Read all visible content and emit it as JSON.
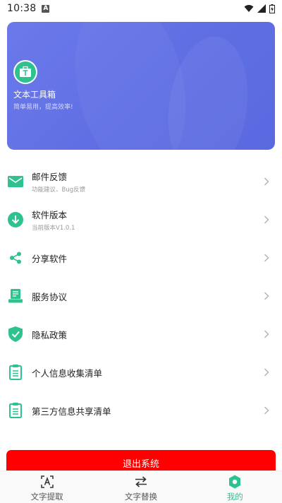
{
  "status_bar": {
    "time": "10:38",
    "notif_letter": "A"
  },
  "profile": {
    "app_name": "文本工具箱",
    "slogan": "简单易用，提高效率!"
  },
  "menu": [
    {
      "title": "邮件反馈",
      "subtitle": "功能建议、Bug反馈",
      "icon": "mail-icon"
    },
    {
      "title": "软件版本",
      "subtitle": "当前版本V1.0.1",
      "icon": "download-icon"
    },
    {
      "title": "分享软件",
      "subtitle": "",
      "icon": "share-icon"
    },
    {
      "title": "服务协议",
      "subtitle": "",
      "icon": "agreement-icon"
    },
    {
      "title": "隐私政策",
      "subtitle": "",
      "icon": "shield-check-icon"
    },
    {
      "title": "个人信息收集清单",
      "subtitle": "",
      "icon": "clipboard-icon"
    },
    {
      "title": "第三方信息共享清单",
      "subtitle": "",
      "icon": "clipboard-icon"
    }
  ],
  "logout_label": "退出系统",
  "bottom_nav": [
    {
      "label": "文字提取",
      "icon": "text-scan-icon",
      "active": false
    },
    {
      "label": "文字替换",
      "icon": "swap-icon",
      "active": false
    },
    {
      "label": "我的",
      "icon": "hexagon-icon",
      "active": true
    }
  ],
  "colors": {
    "accent": "#2ec28e",
    "header": "#6272e6",
    "logout": "#ff0000"
  }
}
